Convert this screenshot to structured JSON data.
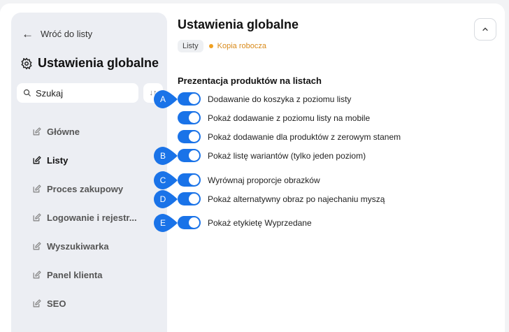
{
  "sidebar": {
    "back_label": "Wróć do listy",
    "title": "Ustawienia globalne",
    "search": {
      "placeholder": "Szukaj"
    },
    "items": [
      {
        "label": "Główne",
        "active": false
      },
      {
        "label": "Listy",
        "active": true
      },
      {
        "label": "Proces zakupowy",
        "active": false
      },
      {
        "label": "Logowanie i rejestr...",
        "active": false
      },
      {
        "label": "Wyszukiwarka",
        "active": false
      },
      {
        "label": "Panel klienta",
        "active": false
      },
      {
        "label": "SEO",
        "active": false
      }
    ]
  },
  "main": {
    "title": "Ustawienia globalne",
    "tag": "Listy",
    "status": "Kopia robocza",
    "section_title": "Prezentacja produktów na listach",
    "settings": [
      {
        "label": "Dodawanie do koszyka z poziomu listy",
        "enabled": true,
        "marker": "A"
      },
      {
        "label": "Pokaż dodawanie z poziomu listy na mobile",
        "enabled": true,
        "marker": ""
      },
      {
        "label": "Pokaż dodawanie dla produktów z zerowym stanem",
        "enabled": true,
        "marker": ""
      },
      {
        "label": "Pokaż listę wariantów (tylko jeden poziom)",
        "enabled": true,
        "marker": "B"
      },
      {
        "label": "Wyrównaj proporcje obrazków",
        "enabled": true,
        "marker": "C"
      },
      {
        "label": "Pokaż alternatywny obraz po najechaniu myszą",
        "enabled": true,
        "marker": "D"
      },
      {
        "label": "Pokaż etykietę Wyprzedane",
        "enabled": true,
        "marker": "E"
      }
    ]
  },
  "colors": {
    "accent": "#1a73e8",
    "draft": "#f0a020",
    "sidebar_bg": "#eceef3"
  }
}
